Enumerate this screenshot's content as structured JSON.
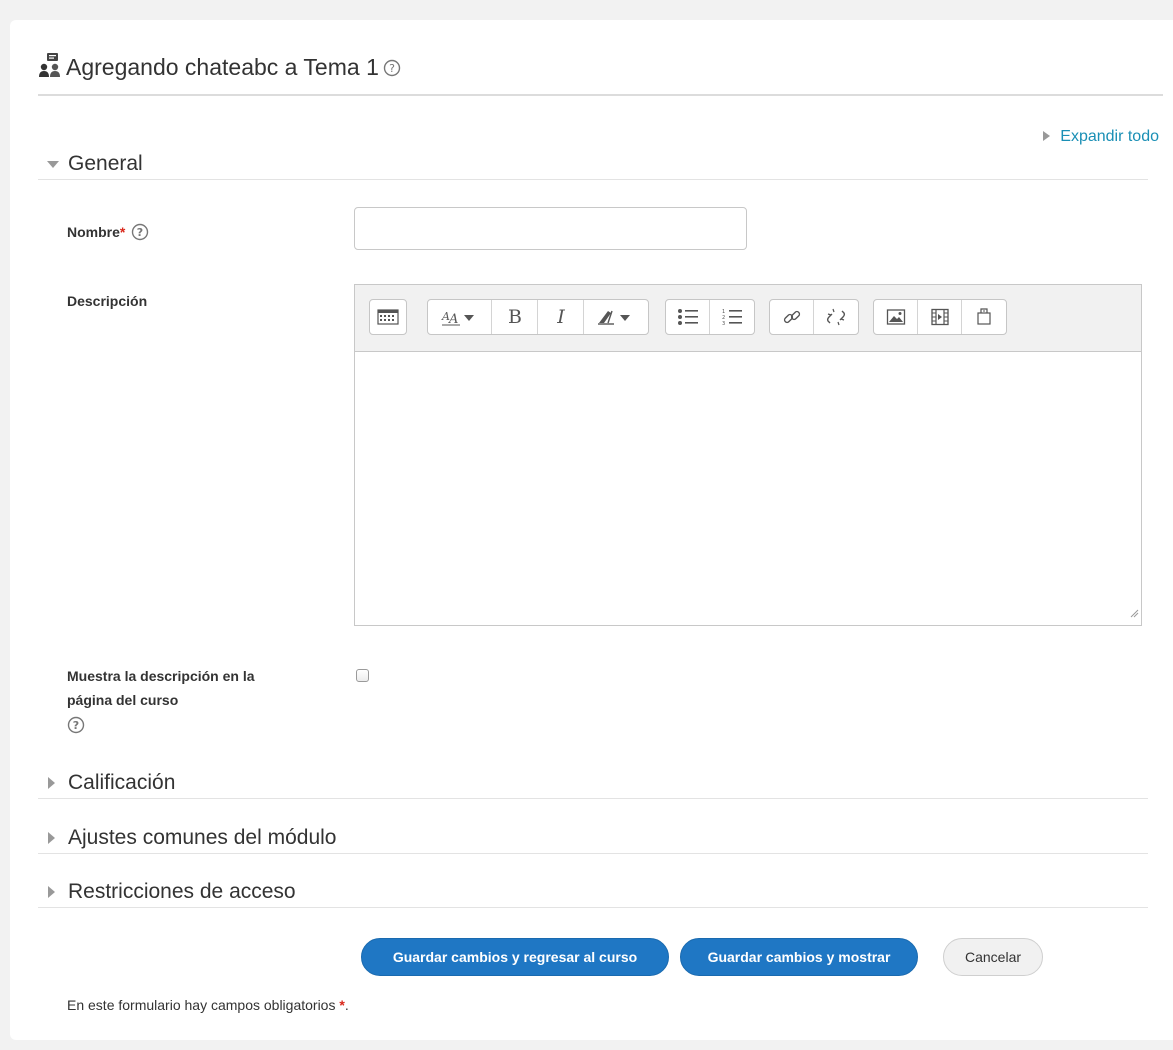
{
  "header": {
    "title": "Agregando chateabc a Tema 1",
    "module_icon": "chat-icon",
    "help_icon": "help-icon"
  },
  "expand_all_label": "Expandir todo",
  "sections": {
    "general": "General",
    "grading": "Calificación",
    "common_module": "Ajustes comunes del módulo",
    "access_restrictions": "Restricciones de acceso"
  },
  "form": {
    "name_label": "Nombre",
    "name_value": "",
    "required_mark": "*",
    "description_label": "Descripción",
    "show_description_label_line1": "Muestra la descripción en la",
    "show_description_label_line2": "página del curso",
    "show_description_checked": false
  },
  "editor": {
    "toolbar_icons": [
      "toolbar-toggle-icon",
      "font-style-icon",
      "bold-icon",
      "italic-icon",
      "clear-format-icon",
      "unordered-list-icon",
      "ordered-list-icon",
      "link-icon",
      "unlink-icon",
      "image-icon",
      "media-icon",
      "file-manager-icon"
    ],
    "content": ""
  },
  "buttons": {
    "save_return": "Guardar cambios y regresar al curso",
    "save_display": "Guardar cambios y mostrar",
    "cancel": "Cancelar"
  },
  "footnote": {
    "text": "En este formulario hay campos obligatorios ",
    "star": "*",
    "end": "."
  },
  "colors": {
    "link": "#1a8fb5",
    "primary": "#1f77c4",
    "required": "#d9281b"
  }
}
